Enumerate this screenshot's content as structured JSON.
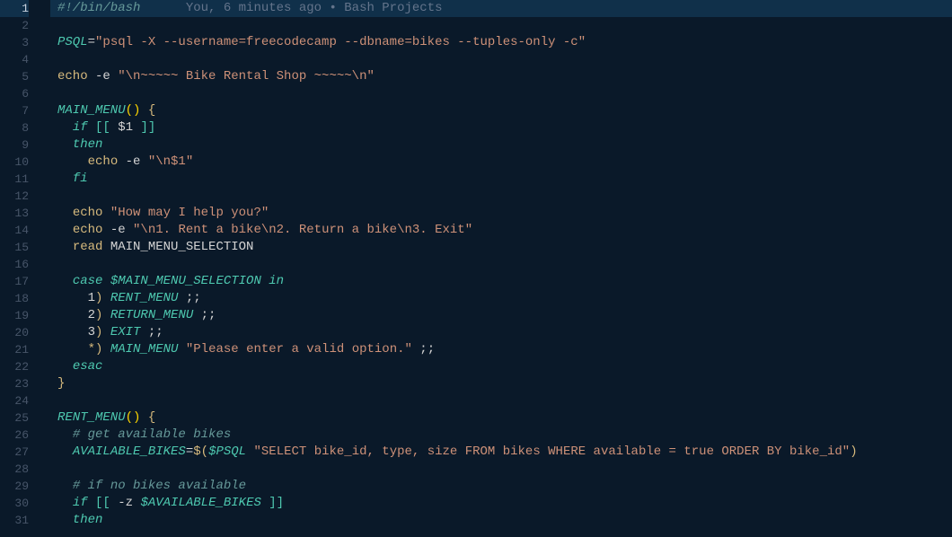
{
  "codelens": "You, 6 minutes ago • Bash Projects",
  "lines": [
    {
      "n": 1,
      "hl": true,
      "tokens": [
        {
          "cls": "c-comment",
          "t": "#!/bin/bash"
        },
        {
          "cls": "c-lens",
          "t": "      "
        },
        {
          "cls": "c-lens",
          "bind": "codelens"
        }
      ]
    },
    {
      "n": 2,
      "tokens": []
    },
    {
      "n": 3,
      "tokens": [
        {
          "cls": "c-var",
          "t": "PSQL"
        },
        {
          "cls": "c-op",
          "t": "="
        },
        {
          "cls": "c-str",
          "t": "\"psql -X --username=freecodecamp --dbname=bikes --tuples-only -c\""
        }
      ]
    },
    {
      "n": 4,
      "tokens": []
    },
    {
      "n": 5,
      "tokens": [
        {
          "cls": "c-cmd",
          "t": "echo"
        },
        {
          "cls": "c-plain",
          "t": " -e "
        },
        {
          "cls": "c-str",
          "t": "\"\\n~~~~~ Bike Rental Shop ~~~~~\\n\""
        }
      ]
    },
    {
      "n": 6,
      "tokens": []
    },
    {
      "n": 7,
      "tokens": [
        {
          "cls": "c-var",
          "t": "MAIN_MENU"
        },
        {
          "cls": "c-paren",
          "t": "()"
        },
        {
          "cls": "c-plain",
          "t": " "
        },
        {
          "cls": "c-gold",
          "t": "{"
        }
      ]
    },
    {
      "n": 8,
      "tokens": [
        {
          "cls": "c-plain",
          "t": "  "
        },
        {
          "cls": "c-keyword",
          "t": "if"
        },
        {
          "cls": "c-plain",
          "t": " "
        },
        {
          "cls": "c-brack",
          "t": "[["
        },
        {
          "cls": "c-plain",
          "t": " $1 "
        },
        {
          "cls": "c-brack",
          "t": "]]"
        }
      ]
    },
    {
      "n": 9,
      "tokens": [
        {
          "cls": "c-plain",
          "t": "  "
        },
        {
          "cls": "c-keyword",
          "t": "then"
        }
      ]
    },
    {
      "n": 10,
      "tokens": [
        {
          "cls": "c-plain",
          "t": "    "
        },
        {
          "cls": "c-cmd",
          "t": "echo"
        },
        {
          "cls": "c-plain",
          "t": " -e "
        },
        {
          "cls": "c-str",
          "t": "\"\\n$1\""
        }
      ]
    },
    {
      "n": 11,
      "tokens": [
        {
          "cls": "c-plain",
          "t": "  "
        },
        {
          "cls": "c-keyword",
          "t": "fi"
        }
      ]
    },
    {
      "n": 12,
      "tokens": []
    },
    {
      "n": 13,
      "tokens": [
        {
          "cls": "c-plain",
          "t": "  "
        },
        {
          "cls": "c-cmd",
          "t": "echo"
        },
        {
          "cls": "c-plain",
          "t": " "
        },
        {
          "cls": "c-str",
          "t": "\"How may I help you?\""
        }
      ]
    },
    {
      "n": 14,
      "tokens": [
        {
          "cls": "c-plain",
          "t": "  "
        },
        {
          "cls": "c-cmd",
          "t": "echo"
        },
        {
          "cls": "c-plain",
          "t": " -e "
        },
        {
          "cls": "c-str",
          "t": "\"\\n1. Rent a bike\\n2. Return a bike\\n3. Exit\""
        }
      ]
    },
    {
      "n": 15,
      "tokens": [
        {
          "cls": "c-plain",
          "t": "  "
        },
        {
          "cls": "c-cmd",
          "t": "read"
        },
        {
          "cls": "c-plain",
          "t": " MAIN_MENU_SELECTION"
        }
      ]
    },
    {
      "n": 16,
      "tokens": []
    },
    {
      "n": 17,
      "tokens": [
        {
          "cls": "c-plain",
          "t": "  "
        },
        {
          "cls": "c-keyword",
          "t": "case"
        },
        {
          "cls": "c-plain",
          "t": " "
        },
        {
          "cls": "c-var",
          "t": "$MAIN_MENU_SELECTION"
        },
        {
          "cls": "c-plain",
          "t": " "
        },
        {
          "cls": "c-keyword",
          "t": "in"
        }
      ]
    },
    {
      "n": 18,
      "tokens": [
        {
          "cls": "c-plain",
          "t": "    1"
        },
        {
          "cls": "c-gold",
          "t": ")"
        },
        {
          "cls": "c-plain",
          "t": " "
        },
        {
          "cls": "c-var",
          "t": "RENT_MENU"
        },
        {
          "cls": "c-plain",
          "t": " ;;"
        }
      ]
    },
    {
      "n": 19,
      "tokens": [
        {
          "cls": "c-plain",
          "t": "    2"
        },
        {
          "cls": "c-gold",
          "t": ")"
        },
        {
          "cls": "c-plain",
          "t": " "
        },
        {
          "cls": "c-var",
          "t": "RETURN_MENU"
        },
        {
          "cls": "c-plain",
          "t": " ;;"
        }
      ]
    },
    {
      "n": 20,
      "tokens": [
        {
          "cls": "c-plain",
          "t": "    3"
        },
        {
          "cls": "c-gold",
          "t": ")"
        },
        {
          "cls": "c-plain",
          "t": " "
        },
        {
          "cls": "c-var",
          "t": "EXIT"
        },
        {
          "cls": "c-plain",
          "t": " ;;"
        }
      ]
    },
    {
      "n": 21,
      "tokens": [
        {
          "cls": "c-plain",
          "t": "    "
        },
        {
          "cls": "c-gold",
          "t": "*)"
        },
        {
          "cls": "c-plain",
          "t": " "
        },
        {
          "cls": "c-var",
          "t": "MAIN_MENU"
        },
        {
          "cls": "c-plain",
          "t": " "
        },
        {
          "cls": "c-str",
          "t": "\"Please enter a valid option.\""
        },
        {
          "cls": "c-plain",
          "t": " ;;"
        }
      ]
    },
    {
      "n": 22,
      "tokens": [
        {
          "cls": "c-plain",
          "t": "  "
        },
        {
          "cls": "c-keyword",
          "t": "esac"
        }
      ]
    },
    {
      "n": 23,
      "tokens": [
        {
          "cls": "c-gold",
          "t": "}"
        }
      ]
    },
    {
      "n": 24,
      "tokens": []
    },
    {
      "n": 25,
      "tokens": [
        {
          "cls": "c-var",
          "t": "RENT_MENU"
        },
        {
          "cls": "c-paren",
          "t": "()"
        },
        {
          "cls": "c-plain",
          "t": " "
        },
        {
          "cls": "c-gold",
          "t": "{"
        }
      ]
    },
    {
      "n": 26,
      "tokens": [
        {
          "cls": "c-plain",
          "t": "  "
        },
        {
          "cls": "c-comment",
          "t": "# get available bikes"
        }
      ]
    },
    {
      "n": 27,
      "tokens": [
        {
          "cls": "c-plain",
          "t": "  "
        },
        {
          "cls": "c-var",
          "t": "AVAILABLE_BIKES"
        },
        {
          "cls": "c-op",
          "t": "="
        },
        {
          "cls": "c-gold",
          "t": "$("
        },
        {
          "cls": "c-var",
          "t": "$PSQL"
        },
        {
          "cls": "c-plain",
          "t": " "
        },
        {
          "cls": "c-str",
          "t": "\"SELECT bike_id, type, size FROM bikes WHERE available = true ORDER BY bike_id\""
        },
        {
          "cls": "c-gold",
          "t": ")"
        }
      ]
    },
    {
      "n": 28,
      "tokens": []
    },
    {
      "n": 29,
      "tokens": [
        {
          "cls": "c-plain",
          "t": "  "
        },
        {
          "cls": "c-comment",
          "t": "# if no bikes available"
        }
      ]
    },
    {
      "n": 30,
      "tokens": [
        {
          "cls": "c-plain",
          "t": "  "
        },
        {
          "cls": "c-keyword",
          "t": "if"
        },
        {
          "cls": "c-plain",
          "t": " "
        },
        {
          "cls": "c-brack",
          "t": "[["
        },
        {
          "cls": "c-plain",
          "t": " -z "
        },
        {
          "cls": "c-var",
          "t": "$AVAILABLE_BIKES"
        },
        {
          "cls": "c-plain",
          "t": " "
        },
        {
          "cls": "c-brack",
          "t": "]]"
        }
      ]
    },
    {
      "n": 31,
      "tokens": [
        {
          "cls": "c-plain",
          "t": "  "
        },
        {
          "cls": "c-keyword",
          "t": "then"
        }
      ]
    }
  ]
}
